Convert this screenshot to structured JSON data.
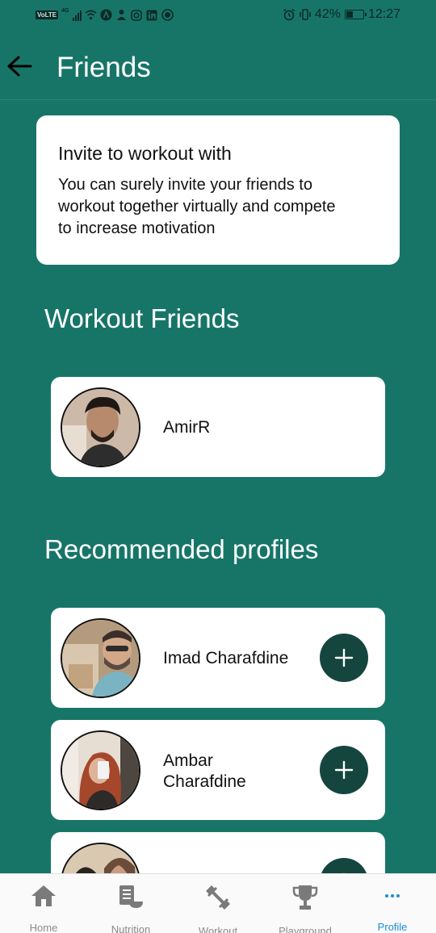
{
  "status_bar": {
    "volte": "VoLTE",
    "network": "4G",
    "battery_percent": "42%",
    "battery_level": 0.42,
    "time": "12:27"
  },
  "header": {
    "title": "Friends",
    "back_icon": "arrow-left-icon"
  },
  "invite": {
    "title": "Invite to workout with",
    "text": "You can surely invite your friends to workout together virtually and compete to increase motivation"
  },
  "workout_friends": {
    "title": "Workout Friends",
    "items": [
      {
        "name": "AmirR"
      }
    ]
  },
  "recommended": {
    "title": "Recommended profiles",
    "items": [
      {
        "name": "Imad Charafdine"
      },
      {
        "name_line1": "Ambar",
        "name_line2": "Charafdine"
      },
      {
        "name": ""
      }
    ]
  },
  "bottom_nav": {
    "items": [
      {
        "label": "Home",
        "icon": "home-icon"
      },
      {
        "label": "Nutrition",
        "icon": "nutrition-icon"
      },
      {
        "label": "Workout",
        "icon": "dumbbell-icon"
      },
      {
        "label": "Playground",
        "icon": "trophy-icon"
      },
      {
        "label": "Profile",
        "icon": "more-dots-icon"
      }
    ],
    "active_index": 4
  },
  "colors": {
    "background": "#177568",
    "add_button": "#14463f",
    "active_nav": "#1a8fd6",
    "inactive_nav": "#8a8a8a"
  }
}
